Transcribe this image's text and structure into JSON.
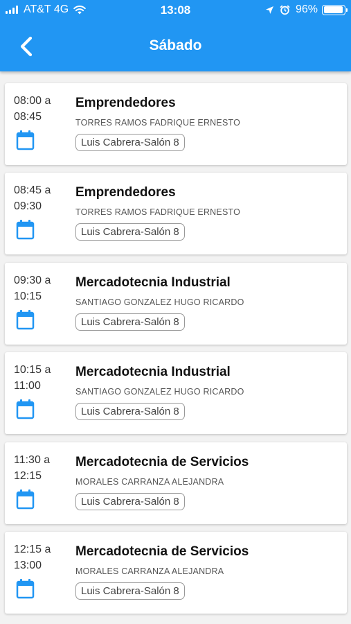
{
  "status_bar": {
    "carrier": "AT&T 4G",
    "time": "13:08",
    "battery": "96%",
    "battery_level": 0.96
  },
  "header": {
    "title": "Sábado",
    "back_icon": "chevron-left-icon"
  },
  "colors": {
    "header": "#2196f3",
    "calendar_icon": "#2196f3"
  },
  "sessions": [
    {
      "time_start": "08:00 a",
      "time_end": "08:45",
      "course": "Emprendedores",
      "teacher": "TORRES RAMOS FADRIQUE ERNESTO",
      "room": "Luis Cabrera-Salón 8"
    },
    {
      "time_start": "08:45 a",
      "time_end": "09:30",
      "course": "Emprendedores",
      "teacher": "TORRES RAMOS FADRIQUE ERNESTO",
      "room": "Luis Cabrera-Salón 8"
    },
    {
      "time_start": "09:30 a",
      "time_end": "10:15",
      "course": "Mercadotecnia Industrial",
      "teacher": "SANTIAGO GONZALEZ HUGO RICARDO",
      "room": "Luis Cabrera-Salón 8"
    },
    {
      "time_start": "10:15 a",
      "time_end": "11:00",
      "course": "Mercadotecnia Industrial",
      "teacher": "SANTIAGO GONZALEZ HUGO RICARDO",
      "room": "Luis Cabrera-Salón 8"
    },
    {
      "time_start": "11:30 a",
      "time_end": "12:15",
      "course": "Mercadotecnia de Servicios",
      "teacher": "MORALES CARRANZA ALEJANDRA",
      "room": "Luis Cabrera-Salón 8"
    },
    {
      "time_start": "12:15 a",
      "time_end": "13:00",
      "course": "Mercadotecnia de Servicios",
      "teacher": "MORALES CARRANZA ALEJANDRA",
      "room": "Luis Cabrera-Salón 8"
    }
  ]
}
